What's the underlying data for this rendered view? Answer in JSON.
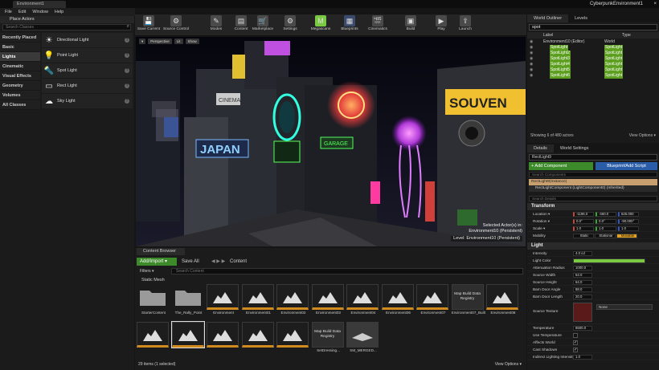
{
  "window": {
    "tab": "Environment1",
    "app_title": "CyberpunkEnvironment1",
    "close": "×"
  },
  "menu": [
    "File",
    "Edit",
    "Window",
    "Help"
  ],
  "place_actors": {
    "title": "Place Actors",
    "search_placeholder": "Search Classes",
    "categories": [
      "Recently Placed",
      "Basic",
      "Lights",
      "Cinematic",
      "Visual Effects",
      "Geometry",
      "Volumes",
      "All Classes"
    ],
    "selected_category": "Lights",
    "items": [
      {
        "label": "Directional Light",
        "icon": "directional-light-icon",
        "glyph": "☀"
      },
      {
        "label": "Point Light",
        "icon": "point-light-icon",
        "glyph": "💡"
      },
      {
        "label": "Spot Light",
        "icon": "spot-light-icon",
        "glyph": "🔦"
      },
      {
        "label": "Rect Light",
        "icon": "rect-light-icon",
        "glyph": "▭"
      },
      {
        "label": "Sky Light",
        "icon": "sky-light-icon",
        "glyph": "☁"
      }
    ]
  },
  "toolbar": [
    {
      "label": "Save Current",
      "icon": "save-icon",
      "glyph": "💾",
      "color": "#4a4a4a"
    },
    {
      "label": "Source Control",
      "icon": "source-control-icon",
      "glyph": "⚙",
      "color": "#4a4a4a"
    },
    {
      "label": "Modes",
      "icon": "modes-icon",
      "glyph": "✎",
      "color": "#4a4a4a"
    },
    {
      "label": "Content",
      "icon": "content-icon",
      "glyph": "▤",
      "color": "#4a4a4a"
    },
    {
      "label": "Marketplace",
      "icon": "marketplace-icon",
      "glyph": "🛒",
      "color": "#4a4a4a"
    },
    {
      "label": "Settings",
      "icon": "settings-icon",
      "glyph": "⚙",
      "color": "#4a4a4a"
    },
    {
      "label": "Megascans",
      "icon": "megascans-icon",
      "glyph": "M",
      "color": "#7ac943"
    },
    {
      "label": "Blueprints",
      "icon": "blueprints-icon",
      "glyph": "▦",
      "color": "#3a4a6a"
    },
    {
      "label": "Cinematics",
      "icon": "cinematics-icon",
      "glyph": "🎬",
      "color": "#4a4a4a"
    },
    {
      "label": "Build",
      "icon": "build-icon",
      "glyph": "▣",
      "color": "#4a4a4a"
    },
    {
      "label": "Play",
      "icon": "play-icon",
      "glyph": "▶",
      "color": "#4a4a4a"
    },
    {
      "label": "Launch",
      "icon": "launch-icon",
      "glyph": "⇪",
      "color": "#4a4a4a"
    }
  ],
  "viewport": {
    "buttons": [
      "▾",
      "Perspective",
      "Lit",
      "Show"
    ],
    "selected_text": "Selected Actor(s) in:",
    "persistent_text": "Environment10 (Persistent)",
    "level_label": "Level:",
    "level_value": "Environment10 (Persistent)",
    "signs": [
      "CINEMA",
      "SOUVEN",
      "JAPAN",
      "GARAGE"
    ]
  },
  "outliner": {
    "tabs": [
      "World Outliner",
      "Levels"
    ],
    "search_value": "spot",
    "col_label": "Label",
    "col_type": "Type",
    "rows": [
      {
        "label": "Environment10 (Editor)",
        "type": "World",
        "hl": false
      },
      {
        "label": "SpotLight",
        "type": "SpotLight",
        "hl": true
      },
      {
        "label": "SpotLight2",
        "type": "SpotLight",
        "hl": true
      },
      {
        "label": "SpotLight3",
        "type": "SpotLight",
        "hl": true
      },
      {
        "label": "SpotLight4",
        "type": "SpotLight",
        "hl": true
      },
      {
        "label": "SpotLight5",
        "type": "SpotLight",
        "hl": true
      },
      {
        "label": "SpotLight6",
        "type": "SpotLight",
        "hl": true
      }
    ],
    "footer": "Showing 6 of 480 actors",
    "view_options": "View Options ▾"
  },
  "details": {
    "tabs": [
      "Details",
      "World Settings"
    ],
    "actor_name": "RectLight9",
    "add_component": "+ Add Component",
    "blueprint": "Blueprint/Add Script",
    "search_components": "Search Components",
    "component_root": "RectLight9(Instance)",
    "component_child": "RectLightComponent (LightComponent0) (Inherited)",
    "search_details": "Search Details",
    "transform_title": "Transform",
    "location_label": "Location ▾",
    "location": [
      "-1196.0",
      "-460.0",
      "625.000"
    ],
    "rotation_label": "Rotation ▾",
    "rotation": [
      "0.0°",
      "0.0°",
      "-90.000°"
    ],
    "scale_label": "Scale ▾",
    "scale": [
      "1.0",
      "1.0",
      "1.0"
    ],
    "mobility_label": "Mobility",
    "mobility": [
      "Static",
      "Stationar",
      "Movable"
    ],
    "light_title": "Light",
    "light_props": [
      {
        "label": "Intensity",
        "value": "4.0 cd"
      },
      {
        "label": "Light Color",
        "value": ""
      },
      {
        "label": "Attenuation Radius",
        "value": "1000.0"
      },
      {
        "label": "Source Width",
        "value": "64.0"
      },
      {
        "label": "Source Height",
        "value": "64.0"
      },
      {
        "label": "Barn Door Angle",
        "value": "88.0"
      },
      {
        "label": "Barn Door Length",
        "value": "20.0"
      }
    ],
    "source_texture": "Source Texture",
    "none_label": "None",
    "lower_props": [
      {
        "label": "Temperature",
        "value": "6500.0"
      },
      {
        "label": "Use Temperature",
        "check": ""
      },
      {
        "label": "Affects World",
        "check": "✓"
      },
      {
        "label": "Cast Shadows",
        "check": "✓"
      },
      {
        "label": "Indirect Lighting Intensity",
        "value": "1.0"
      }
    ],
    "light_color_hex": "#7ac943"
  },
  "content_browser": {
    "tab": "Content Browser",
    "add_import": "Add/Import ▾",
    "save_all": "Save All",
    "path": "Content",
    "filters": "Filters ▾",
    "search_placeholder": "Search Content",
    "filter_tag": "Static Mesh",
    "assets_row1": [
      {
        "label": "StarterContent",
        "kind": "folder"
      },
      {
        "label": "The_Rally_Point",
        "kind": "folder"
      },
      {
        "label": "Environment",
        "kind": "env"
      },
      {
        "label": "Environment01",
        "kind": "env"
      },
      {
        "label": "Environment02",
        "kind": "env"
      },
      {
        "label": "Environment03",
        "kind": "env"
      },
      {
        "label": "Environment04",
        "kind": "env"
      },
      {
        "label": "Environment06",
        "kind": "env"
      },
      {
        "label": "Environment07",
        "kind": "env"
      },
      {
        "label": "Environment07_BuiltData",
        "kind": "data",
        "thumb_text": "Map Build Data Registry"
      },
      {
        "label": "Environment08",
        "kind": "env"
      }
    ],
    "assets_row2": [
      {
        "label": "",
        "kind": "env"
      },
      {
        "label": "",
        "kind": "env",
        "selected": true
      },
      {
        "label": "",
        "kind": "env"
      },
      {
        "label": "",
        "kind": "env"
      },
      {
        "label": "",
        "kind": "env"
      },
      {
        "label": "SetDressing...",
        "kind": "data",
        "thumb_text": "Map Build Data Registry"
      },
      {
        "label": "SM_MERGED...",
        "kind": "mesh"
      }
    ],
    "footer": "29 items (1 selected)",
    "view_options": "View Options ▾"
  }
}
